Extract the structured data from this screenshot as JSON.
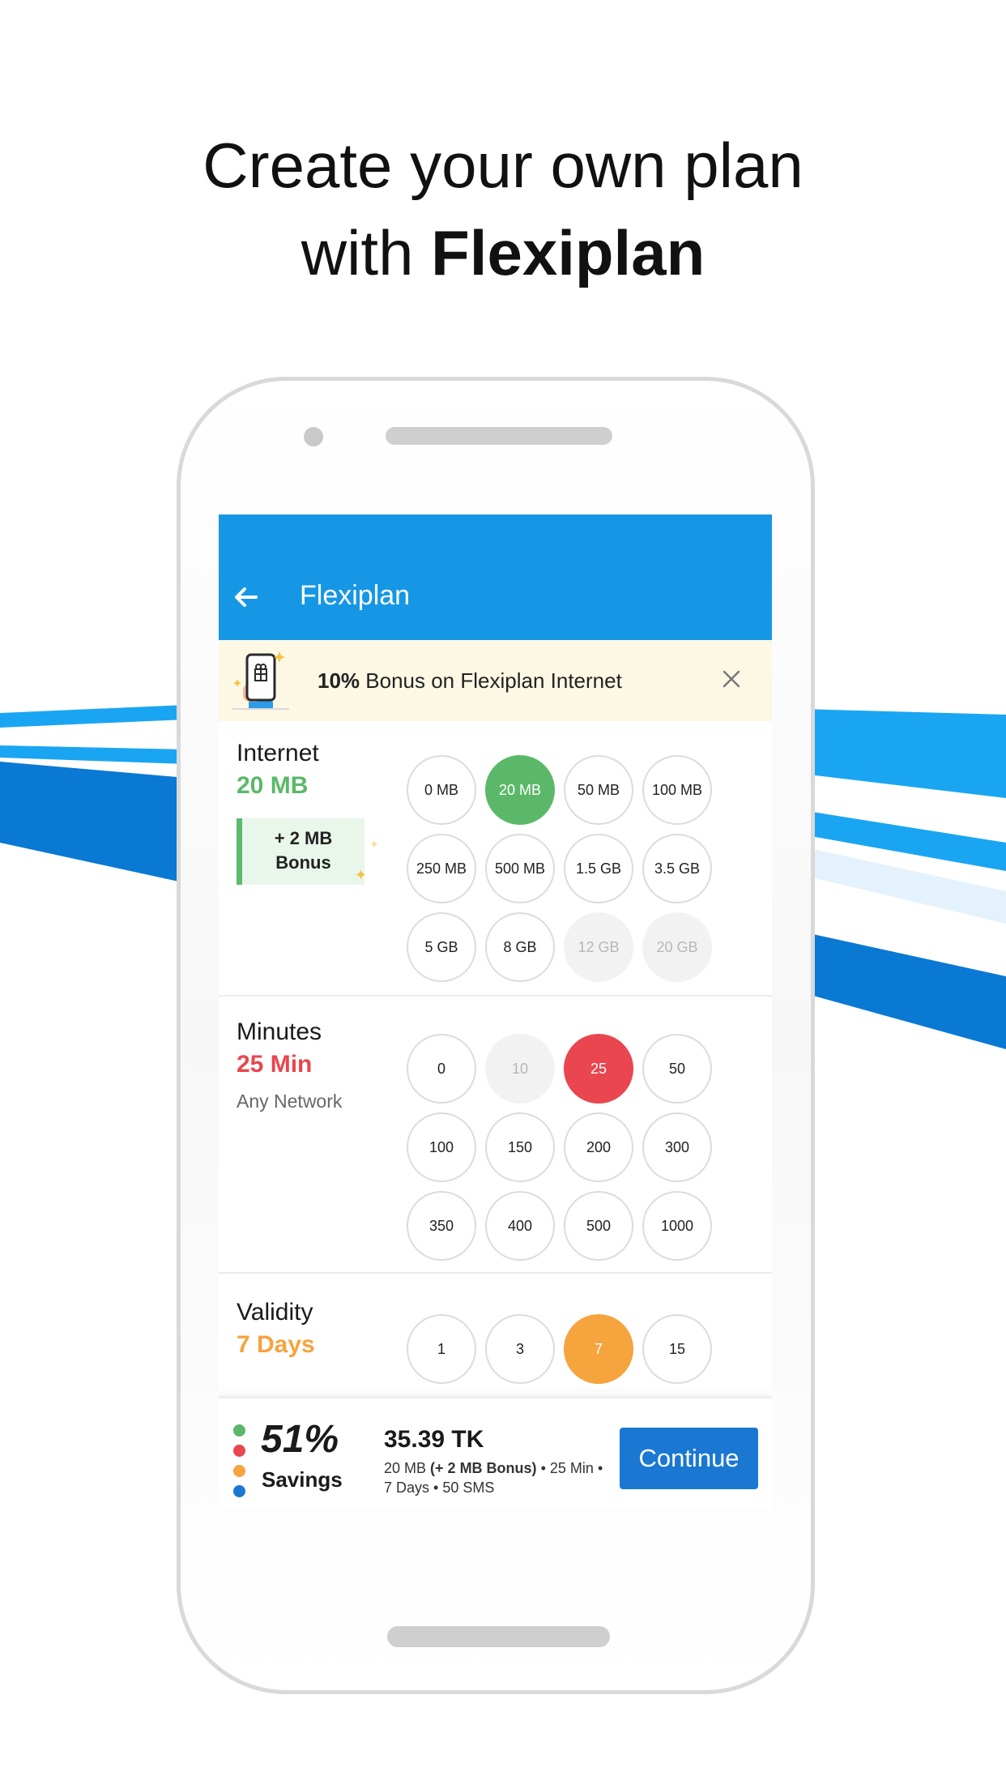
{
  "headline": {
    "line1": "Create your own plan",
    "line2_prefix": "with",
    "line2_bold": "Flexiplan"
  },
  "appbar": {
    "back_icon": "arrow-left-icon",
    "title": "Flexiplan"
  },
  "promo": {
    "bold": "10%",
    "text": "Bonus on Flexiplan Internet",
    "close_icon": "close-icon"
  },
  "internet": {
    "label": "Internet",
    "value": "20 MB",
    "bonus_line1": "+ 2 MB",
    "bonus_line2": "Bonus",
    "options": [
      {
        "label": "0 MB",
        "state": "normal"
      },
      {
        "label": "20 MB",
        "state": "selected"
      },
      {
        "label": "50 MB",
        "state": "normal"
      },
      {
        "label": "100 MB",
        "state": "normal"
      },
      {
        "label": "250 MB",
        "state": "normal"
      },
      {
        "label": "500 MB",
        "state": "normal"
      },
      {
        "label": "1.5 GB",
        "state": "normal"
      },
      {
        "label": "3.5 GB",
        "state": "normal"
      },
      {
        "label": "5 GB",
        "state": "normal"
      },
      {
        "label": "8 GB",
        "state": "normal"
      },
      {
        "label": "12 GB",
        "state": "disabled"
      },
      {
        "label": "20 GB",
        "state": "disabled"
      }
    ]
  },
  "minutes": {
    "label": "Minutes",
    "value": "25 Min",
    "note": "Any Network",
    "options": [
      {
        "label": "0",
        "state": "normal"
      },
      {
        "label": "10",
        "state": "disabled"
      },
      {
        "label": "25",
        "state": "selected"
      },
      {
        "label": "50",
        "state": "normal"
      },
      {
        "label": "100",
        "state": "normal"
      },
      {
        "label": "150",
        "state": "normal"
      },
      {
        "label": "200",
        "state": "normal"
      },
      {
        "label": "300",
        "state": "normal"
      },
      {
        "label": "350",
        "state": "normal"
      },
      {
        "label": "400",
        "state": "normal"
      },
      {
        "label": "500",
        "state": "normal"
      },
      {
        "label": "1000",
        "state": "normal"
      }
    ]
  },
  "validity": {
    "label": "Validity",
    "value": "7 Days",
    "options": [
      {
        "label": "1",
        "state": "normal"
      },
      {
        "label": "3",
        "state": "normal"
      },
      {
        "label": "7",
        "state": "selected"
      },
      {
        "label": "15",
        "state": "normal"
      }
    ]
  },
  "footer": {
    "savings_pct": "51%",
    "savings_label": "Savings",
    "price": "35.39 TK",
    "summary_data": "20 MB",
    "summary_bonus": "(+ 2 MB Bonus)",
    "summary_rest1": "• 25 Min",
    "summary_rest2": "• 7 Days • 50 SMS",
    "continue_label": "Continue"
  },
  "colors": {
    "appbar": "#1697e6",
    "internet": "#5bb868",
    "minutes": "#e9464f",
    "validity": "#f5a43e",
    "sms": "#1a78d2",
    "continue": "#1a78d2",
    "promo_bg": "#fdf8e4"
  }
}
